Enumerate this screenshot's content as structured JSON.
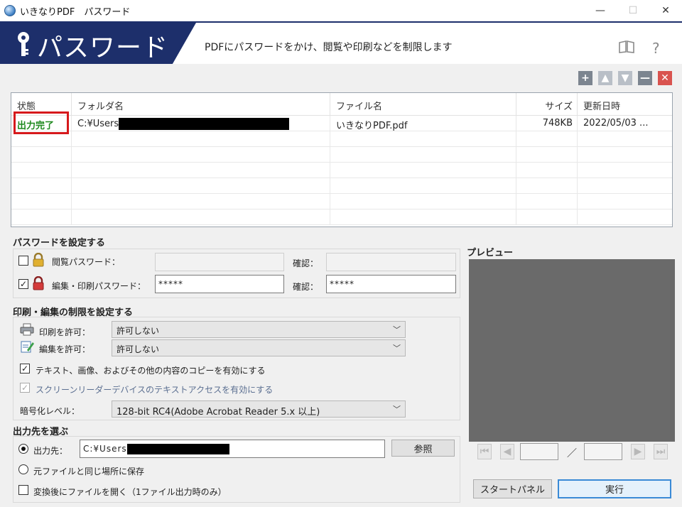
{
  "window": {
    "title": "いきなりPDF　パスワード",
    "controls": [
      "—",
      "☐",
      "✕"
    ]
  },
  "banner": {
    "title": "パスワード",
    "description": "PDFにパスワードをかけ、閲覧や印刷などを制限します",
    "manual_icon": "book-icon",
    "help_icon": "help-icon",
    "help_glyph": "?"
  },
  "list_tools": {
    "add": "+",
    "up": "▲",
    "down": "▼",
    "remove": "—",
    "clear": "✕"
  },
  "table": {
    "columns": [
      "状態",
      "フォルダ名",
      "ファイル名",
      "サイズ",
      "更新日時"
    ],
    "rows": [
      {
        "status": "出力完了",
        "folder": "C:¥Users",
        "file": "いきなりPDF.pdf",
        "size": "748KB",
        "date": "2022/05/03 ..."
      }
    ]
  },
  "password_section": {
    "title": "パスワードを設定する",
    "view_password_label": "閲覧パスワード：",
    "view_password_checked": false,
    "view_password_value": "",
    "view_confirm_label": "確認：",
    "view_confirm_value": "",
    "edit_password_label": "編集・印刷パスワード：",
    "edit_password_checked": true,
    "edit_password_value": "*****",
    "edit_confirm_label": "確認：",
    "edit_confirm_value": "*****"
  },
  "restrict_section": {
    "title": "印刷・編集の制限を設定する",
    "print_label": "印刷を許可：",
    "print_value": "許可しない",
    "edit_label": "編集を許可：",
    "edit_value": "許可しない",
    "copy_label": "テキスト、画像、およびその他の内容のコピーを有効にする",
    "copy_checked": true,
    "reader_label": "スクリーンリーダーデバイスのテキストアクセスを有効にする",
    "reader_checked": true,
    "encrypt_label": "暗号化レベル：",
    "encrypt_value": "128-bit RC4(Adobe Acrobat Reader 5.x 以上)"
  },
  "output_section": {
    "title": "出力先を選ぶ",
    "dest_label": "出力先：",
    "dest_value": "C:¥Users",
    "browse_label": "参照",
    "same_place_label": "元ファイルと同じ場所に保存",
    "open_after_label": "変換後にファイルを開く（1ファイル出力時のみ）",
    "open_after_checked": false
  },
  "preview": {
    "title": "プレビュー",
    "page_separator": "／"
  },
  "footer": {
    "start_panel_label": "スタートパネル",
    "run_label": "実行"
  }
}
